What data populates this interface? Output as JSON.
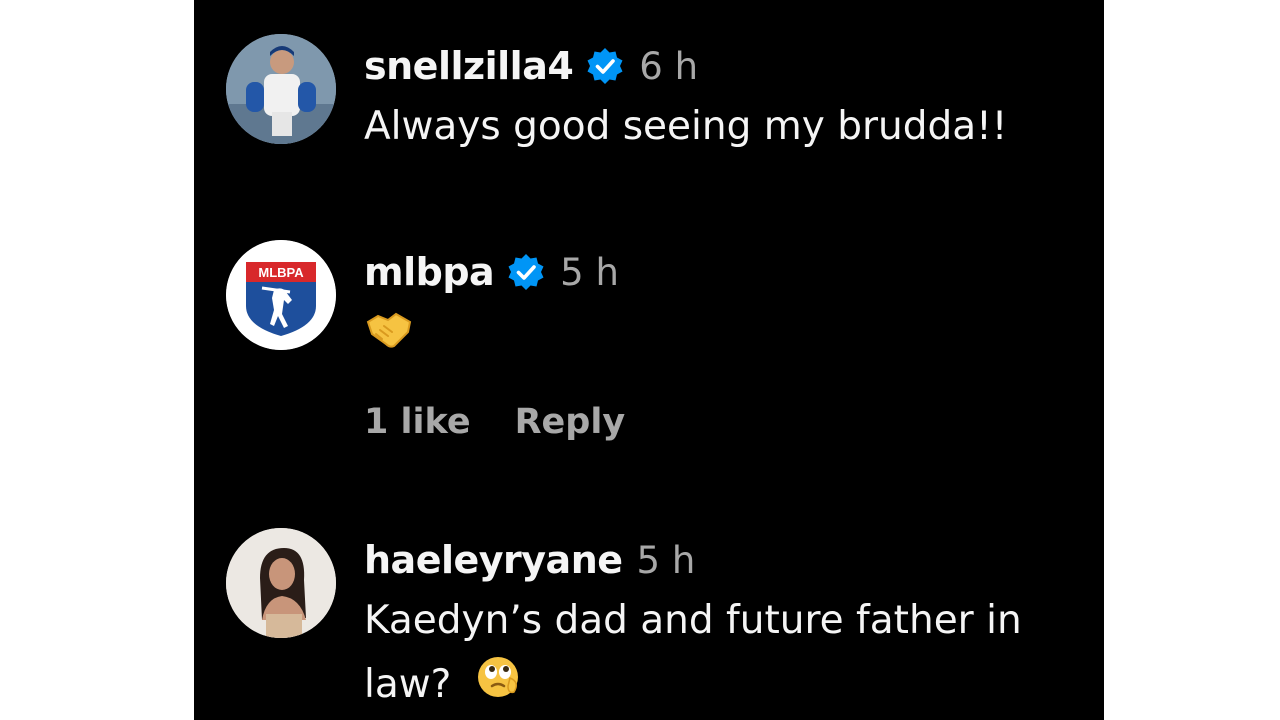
{
  "comments": [
    {
      "username": "snellzilla4",
      "verified": true,
      "time": "6 h",
      "text": "Always good seeing my brudda!!"
    },
    {
      "username": "mlbpa",
      "verified": true,
      "time": "5 h",
      "text": "",
      "emoji": "handshake-emoji",
      "avatar_logo_text": "MLBPA",
      "likes": "1 like",
      "reply_label": "Reply"
    },
    {
      "username": "haeleyryane",
      "verified": false,
      "time": "5 h",
      "text_line1": "Kaedyn’s dad and future father in",
      "text_line2": "law?",
      "emoji": "face-with-rolling-eyes-emoji"
    }
  ],
  "colors": {
    "background": "#000000",
    "text_primary": "#f5f5f5",
    "text_secondary": "#a8a8a8",
    "verified_badge": "#0095f6"
  }
}
